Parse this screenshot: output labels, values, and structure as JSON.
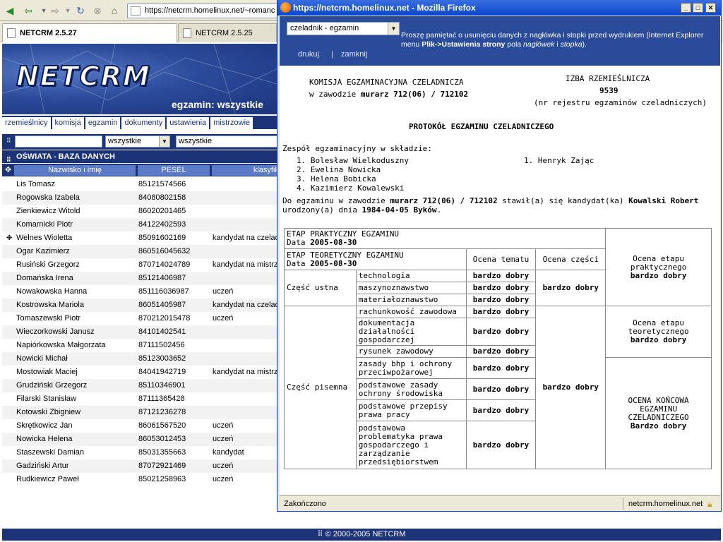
{
  "browser": {
    "url": "https://netcrm.homelinux.net/~romanc",
    "tabs": [
      {
        "label": "NETCRM 2.5.27"
      },
      {
        "label": "NETCRM 2.5.25"
      }
    ]
  },
  "app": {
    "logo": "NETCRM",
    "subtitle": "egzamin: wszystkie",
    "nav": [
      "rzemieślnicy",
      "komisja",
      "egzamin",
      "dokumenty",
      "ustawienia",
      "mistrzowie"
    ],
    "filter": {
      "field1": "wszystkie",
      "field2": "wszystkie"
    },
    "section_title": "OŚWIATA - BAZA DANYCH",
    "columns": [
      "Nazwisko i imię",
      "PESEL",
      "klasyfika"
    ],
    "rows": [
      {
        "name": "Lis Tomasz",
        "pesel": "85121574566",
        "status": ""
      },
      {
        "name": "Rogowska Izabela",
        "pesel": "84080802158",
        "status": ""
      },
      {
        "name": "Zienkiewicz Witold",
        "pesel": "86020201465",
        "status": ""
      },
      {
        "name": "Komarnicki Piotr",
        "pesel": "84122402593",
        "status": ""
      },
      {
        "name": "Welnes Wioletta",
        "pesel": "85091602169",
        "status": "kandydat na czeladnika"
      },
      {
        "name": "Ogar Kazimierz",
        "pesel": "860516045632",
        "status": ""
      },
      {
        "name": "Rusiński Grzegorz",
        "pesel": "870714024789",
        "status": "kandydat na mistrza"
      },
      {
        "name": "Domańska Irena",
        "pesel": "85121406987",
        "status": ""
      },
      {
        "name": "Nowakowska Hanna",
        "pesel": "851116036987",
        "status": "uczeń"
      },
      {
        "name": "Kostrowska Mariola",
        "pesel": "86051405987",
        "status": "kandydat na czeladnika"
      },
      {
        "name": "Tomaszewski Piotr",
        "pesel": "870212015478",
        "status": "uczeń"
      },
      {
        "name": "Wieczorkowski Janusz",
        "pesel": "84101402541",
        "status": ""
      },
      {
        "name": "Napiórkowska Małgorzata",
        "pesel": "87111502456",
        "status": ""
      },
      {
        "name": "Nowicki Michał",
        "pesel": "85123003652",
        "status": ""
      },
      {
        "name": "Mostowiak Maciej",
        "pesel": "84041942719",
        "status": "kandydat na mistrza"
      },
      {
        "name": "Grudziński Grzegorz",
        "pesel": "85110346901",
        "status": ""
      },
      {
        "name": "Filarski Stanisław",
        "pesel": "87111365428",
        "status": ""
      },
      {
        "name": "Kotowski Zbigniew",
        "pesel": "87121236278",
        "status": ""
      },
      {
        "name": "Skrętkowicz Jan",
        "pesel": "86061567520",
        "status": "uczeń"
      },
      {
        "name": "Nowicka Helena",
        "pesel": "86053012453",
        "status": "uczeń"
      },
      {
        "name": "Staszewski Damian",
        "pesel": "85031355663",
        "status": "kandydat"
      },
      {
        "name": "Gadziński Artur",
        "pesel": "87072921469",
        "status": "uczeń"
      },
      {
        "name": "Rudkiewicz Paweł",
        "pesel": "85021258963",
        "status": "uczeń"
      }
    ],
    "footer": "© 2000-2005 NETCRM"
  },
  "popup": {
    "title": "https://netcrm.homelinux.net - Mozilla Firefox",
    "select": "czeladnik - egzamin",
    "note_a": "Proszę pamiętać o usunięciu danych z nagłówka i stopki przed wydrukiem (Internet Explorer menu ",
    "note_b": "Plik->Ustawienia strony",
    "note_c": " pola ",
    "note_d": "nagłówek",
    "note_e": " i ",
    "note_f": "stopka",
    "note_g": ").",
    "link_print": "drukuj",
    "link_sep": "|",
    "link_close": "zamknij",
    "status_left": "Zakończono",
    "status_right": "netcrm.homelinux.net"
  },
  "doc": {
    "commission": "KOMISJA EGZAMINACYJNA CZELADNICZA",
    "in_trade_prefix": "w zawodzie ",
    "trade": "murarz 712(06) / 712102",
    "chamber": "IZBA RZEMIEŚLNICZA",
    "reg_no": "9539",
    "reg_note": "(nr rejestru egzaminów czeladniczych)",
    "heading": "PROTOKÓŁ EGZAMINU CZELADNICZEGO",
    "team_label": "Zespół egzaminacyjny w składzie:",
    "members": [
      "1. Bolesław Wielkoduszny",
      "2. Ewelina Nowicka",
      "3. Helena Bobicka",
      "4. Kazimierz Kowalewski"
    ],
    "member_right": "1. Henryk Zając",
    "intro_a": "Do egzaminu w zawodzie ",
    "intro_b": " stawił(a) się kandydat(ka) ",
    "candidate": "Kowalski Robert",
    "born_prefix": "urodzony(a) dnia ",
    "born": "1984-04-05 Byków",
    "born_suffix": ".",
    "stage_practical": "ETAP PRAKTYCZNY EGZAMINU",
    "date_label": "Data ",
    "date_practical": "2005-08-30",
    "stage_theory": "ETAP TEORETYCZNY EGZAMINU",
    "date_theory": "2005-08-30",
    "col_topic": "Ocena tematu",
    "col_part": "Ocena części",
    "part_oral": "Część ustna",
    "part_written": "Część pisemna",
    "oral_subjects": [
      {
        "name": "technologia",
        "grade": "bardzo dobry"
      },
      {
        "name": "maszynoznawstwo",
        "grade": "bardzo dobry"
      },
      {
        "name": "materiałoznawstwo",
        "grade": "bardzo dobry"
      }
    ],
    "oral_part_grade": "bardzo dobry",
    "written_subjects": [
      {
        "name": "rachunkowość zawodowa",
        "grade": "bardzo dobry"
      },
      {
        "name": "dokumentacja działalności gospodarczej",
        "grade": "bardzo dobry"
      },
      {
        "name": "rysunek zawodowy",
        "grade": "bardzo dobry"
      },
      {
        "name": "zasady bhp i ochrony przeciwpożarowej",
        "grade": "bardzo dobry"
      },
      {
        "name": "podstawowe zasady ochrony środowiska",
        "grade": "bardzo dobry"
      },
      {
        "name": "podstawowe przepisy prawa pracy",
        "grade": "bardzo dobry"
      },
      {
        "name": "podstawowa problematyka prawa gospodarczego i zarządzanie przedsiębiorstwem",
        "grade": "bardzo dobry"
      }
    ],
    "written_part_grade": "bardzo dobry",
    "practical_label": "Ocena etapu praktycznego",
    "practical_grade": "bardzo dobry",
    "theory_label": "Ocena etapu teoretycznego",
    "theory_grade": "bardzo dobry",
    "final_label": "OCENA KOŃCOWA EGZAMINU CZELADNICZEGO",
    "final_grade": "Bardzo dobry"
  }
}
